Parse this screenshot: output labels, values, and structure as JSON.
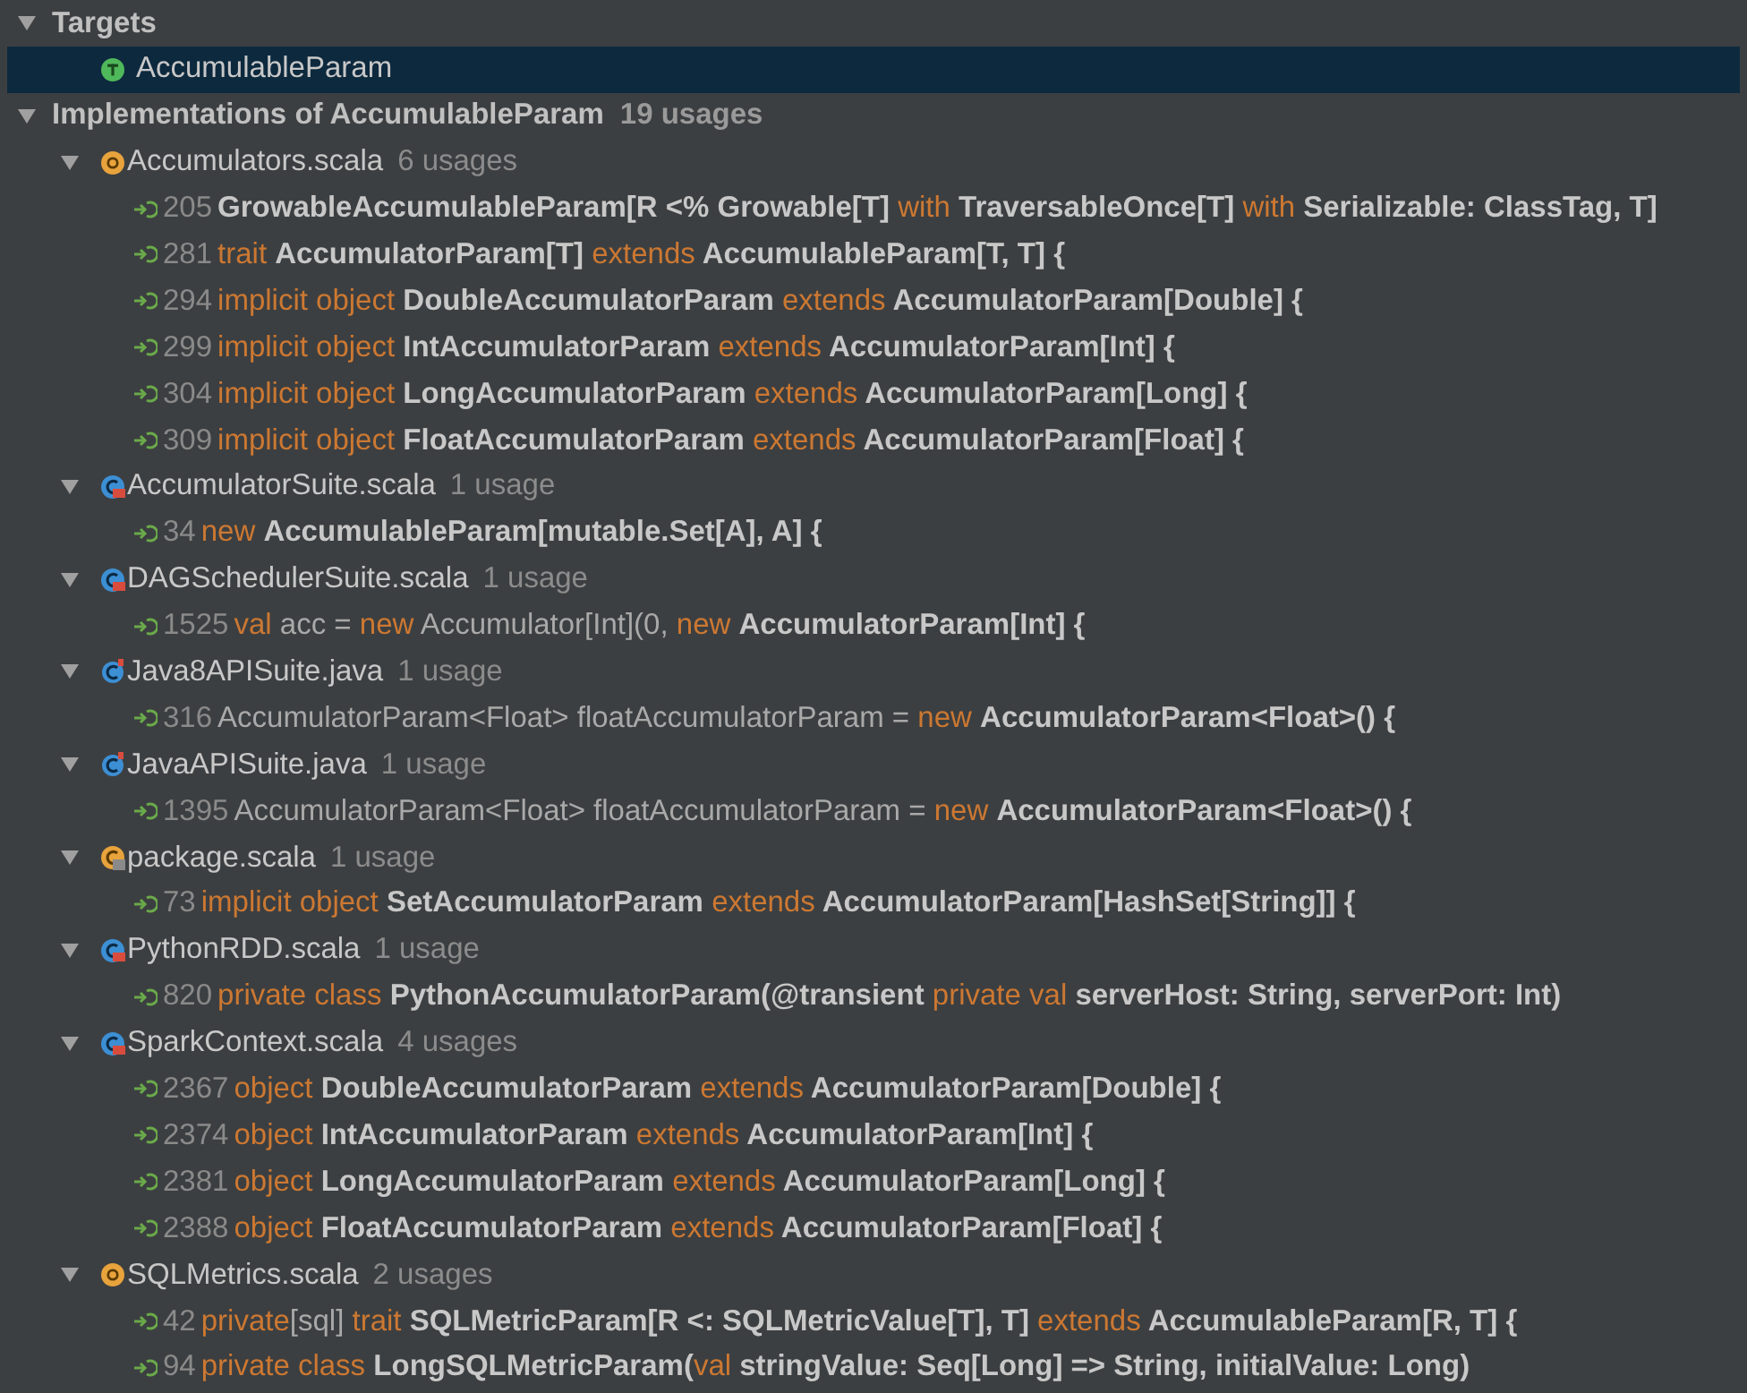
{
  "targets": {
    "label": "Targets",
    "expanded": true,
    "items": [
      {
        "name": "AccumulableParam",
        "selected": true
      }
    ]
  },
  "implementations": {
    "label": "Implementations of AccumulableParam",
    "count": "19 usages",
    "expanded": true,
    "files": [
      {
        "name": "Accumulators.scala",
        "count": "6 usages",
        "kind": "object",
        "expanded": true,
        "usages": [
          {
            "line": "205",
            "spans": [
              {
                "kind": "name",
                "text": "GrowableAccumulableParam[R <% Growable[T] "
              },
              {
                "kind": "keyword",
                "text": "with"
              },
              {
                "kind": "name",
                "text": " TraversableOnce[T] "
              },
              {
                "kind": "keyword",
                "text": "with"
              },
              {
                "kind": "name",
                "text": " Serializable: ClassTag, T]"
              }
            ]
          },
          {
            "line": "281",
            "spans": [
              {
                "kind": "keyword",
                "text": "trait "
              },
              {
                "kind": "name",
                "text": "AccumulatorParam[T] "
              },
              {
                "kind": "keyword",
                "text": "extends"
              },
              {
                "kind": "name",
                "text": " AccumulableParam[T, T] {"
              }
            ]
          },
          {
            "line": "294",
            "spans": [
              {
                "kind": "keyword",
                "text": "implicit object "
              },
              {
                "kind": "name",
                "text": "DoubleAccumulatorParam "
              },
              {
                "kind": "keyword",
                "text": "extends"
              },
              {
                "kind": "name",
                "text": " AccumulatorParam[Double] {"
              }
            ]
          },
          {
            "line": "299",
            "spans": [
              {
                "kind": "keyword",
                "text": "implicit object "
              },
              {
                "kind": "name",
                "text": "IntAccumulatorParam "
              },
              {
                "kind": "keyword",
                "text": "extends"
              },
              {
                "kind": "name",
                "text": " AccumulatorParam[Int] {"
              }
            ]
          },
          {
            "line": "304",
            "spans": [
              {
                "kind": "keyword",
                "text": "implicit object "
              },
              {
                "kind": "name",
                "text": "LongAccumulatorParam "
              },
              {
                "kind": "keyword",
                "text": "extends"
              },
              {
                "kind": "name",
                "text": " AccumulatorParam[Long] {"
              }
            ]
          },
          {
            "line": "309",
            "spans": [
              {
                "kind": "keyword",
                "text": "implicit object "
              },
              {
                "kind": "name",
                "text": "FloatAccumulatorParam "
              },
              {
                "kind": "keyword",
                "text": "extends"
              },
              {
                "kind": "name",
                "text": " AccumulatorParam[Float] {"
              }
            ]
          }
        ]
      },
      {
        "name": "AccumulatorSuite.scala",
        "count": "1 usage",
        "kind": "test-class",
        "expanded": true,
        "usages": [
          {
            "line": "34",
            "spans": [
              {
                "kind": "keyword",
                "text": "new "
              },
              {
                "kind": "name",
                "text": "AccumulableParam[mutable.Set[A], A] {"
              }
            ]
          }
        ]
      },
      {
        "name": "DAGSchedulerSuite.scala",
        "count": "1 usage",
        "kind": "test-class",
        "expanded": true,
        "usages": [
          {
            "line": "1525",
            "spans": [
              {
                "kind": "keyword",
                "text": "val "
              },
              {
                "kind": "plain",
                "text": "acc = "
              },
              {
                "kind": "keyword",
                "text": "new "
              },
              {
                "kind": "plain",
                "text": "Accumulator[Int](0, "
              },
              {
                "kind": "keyword",
                "text": "new "
              },
              {
                "kind": "name",
                "text": "AccumulatorParam[Int] {"
              }
            ]
          }
        ]
      },
      {
        "name": "Java8APISuite.java",
        "count": "1 usage",
        "kind": "java-class",
        "expanded": true,
        "usages": [
          {
            "line": "316",
            "spans": [
              {
                "kind": "plain",
                "text": "AccumulatorParam<Float> floatAccumulatorParam = "
              },
              {
                "kind": "keyword",
                "text": "new "
              },
              {
                "kind": "name",
                "text": "AccumulatorParam<Float>() {"
              }
            ]
          }
        ]
      },
      {
        "name": "JavaAPISuite.java",
        "count": "1 usage",
        "kind": "java-class",
        "expanded": true,
        "usages": [
          {
            "line": "1395",
            "spans": [
              {
                "kind": "plain",
                "text": "AccumulatorParam<Float> floatAccumulatorParam = "
              },
              {
                "kind": "keyword",
                "text": "new "
              },
              {
                "kind": "name",
                "text": "AccumulatorParam<Float>() {"
              }
            ]
          }
        ]
      },
      {
        "name": "package.scala",
        "count": "1 usage",
        "kind": "package-class",
        "expanded": true,
        "usages": [
          {
            "line": "73",
            "spans": [
              {
                "kind": "keyword",
                "text": "implicit object "
              },
              {
                "kind": "name",
                "text": "SetAccumulatorParam "
              },
              {
                "kind": "keyword",
                "text": "extends"
              },
              {
                "kind": "name",
                "text": " AccumulatorParam[HashSet[String]] {"
              }
            ]
          }
        ]
      },
      {
        "name": "PythonRDD.scala",
        "count": "1 usage",
        "kind": "test-class",
        "expanded": true,
        "usages": [
          {
            "line": "820",
            "spans": [
              {
                "kind": "keyword",
                "text": "private class "
              },
              {
                "kind": "name",
                "text": "PythonAccumulatorParam(@transient "
              },
              {
                "kind": "keyword",
                "text": "private val"
              },
              {
                "kind": "name",
                "text": " serverHost: String, serverPort: Int)"
              }
            ]
          }
        ]
      },
      {
        "name": "SparkContext.scala",
        "count": "4 usages",
        "kind": "test-class",
        "expanded": true,
        "usages": [
          {
            "line": "2367",
            "spans": [
              {
                "kind": "keyword",
                "text": "object "
              },
              {
                "kind": "name",
                "text": "DoubleAccumulatorParam "
              },
              {
                "kind": "keyword",
                "text": "extends"
              },
              {
                "kind": "name",
                "text": " AccumulatorParam[Double] {"
              }
            ]
          },
          {
            "line": "2374",
            "spans": [
              {
                "kind": "keyword",
                "text": "object "
              },
              {
                "kind": "name",
                "text": "IntAccumulatorParam "
              },
              {
                "kind": "keyword",
                "text": "extends"
              },
              {
                "kind": "name",
                "text": " AccumulatorParam[Int] {"
              }
            ]
          },
          {
            "line": "2381",
            "spans": [
              {
                "kind": "keyword",
                "text": "object "
              },
              {
                "kind": "name",
                "text": "LongAccumulatorParam "
              },
              {
                "kind": "keyword",
                "text": "extends"
              },
              {
                "kind": "name",
                "text": " AccumulatorParam[Long] {"
              }
            ]
          },
          {
            "line": "2388",
            "spans": [
              {
                "kind": "keyword",
                "text": "object "
              },
              {
                "kind": "name",
                "text": "FloatAccumulatorParam "
              },
              {
                "kind": "keyword",
                "text": "extends"
              },
              {
                "kind": "name",
                "text": " AccumulatorParam[Float] {"
              }
            ]
          }
        ]
      },
      {
        "name": "SQLMetrics.scala",
        "count": "2 usages",
        "kind": "object",
        "expanded": true,
        "usages": [
          {
            "line": "42",
            "spans": [
              {
                "kind": "keyword",
                "text": "private"
              },
              {
                "kind": "plain",
                "text": "[sql] "
              },
              {
                "kind": "keyword",
                "text": "trait "
              },
              {
                "kind": "name",
                "text": "SQLMetricParam[R <: SQLMetricValue[T], T] "
              },
              {
                "kind": "keyword",
                "text": "extends"
              },
              {
                "kind": "name",
                "text": " AccumulableParam[R, T] {"
              }
            ]
          },
          {
            "line": "94",
            "spans": [
              {
                "kind": "keyword",
                "text": "private class "
              },
              {
                "kind": "name",
                "text": "LongSQLMetricParam("
              },
              {
                "kind": "keyword",
                "text": "val"
              },
              {
                "kind": "name",
                "text": " stringValue: Seq[Long] => String, initialValue: Long)"
              }
            ]
          }
        ]
      }
    ]
  }
}
